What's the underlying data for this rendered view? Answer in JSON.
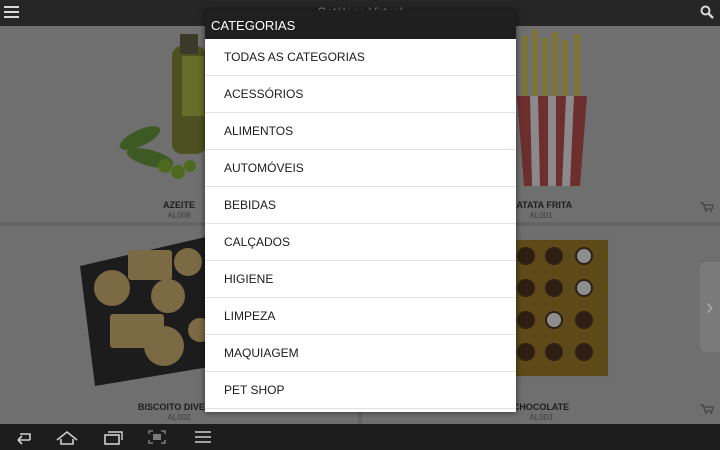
{
  "app": {
    "title": "Catálogo Virtual"
  },
  "topbar": {
    "menu_icon": "menu-icon",
    "search_icon": "search-icon"
  },
  "products": [
    {
      "name": "AZEITE",
      "code": "AL008",
      "image": "olive-oil-bottle"
    },
    {
      "name": "BATATA FRITA",
      "code": "AL001",
      "image": "french-fries"
    },
    {
      "name": "BISCOITO DIVE",
      "code": "AL002",
      "image": "biscuit-tray"
    },
    {
      "name": "CHOCOLATE",
      "code": "AL003",
      "image": "chocolate-box"
    }
  ],
  "category_dialog": {
    "title": "CATEGORIAS",
    "items": [
      "TODAS AS CATEGORIAS",
      "ACESSÓRIOS",
      "ALIMENTOS",
      "AUTOMÓVEIS",
      "BEBIDAS",
      "CALÇADOS",
      "HIGIENE",
      "LIMPEZA",
      "MAQUIAGEM",
      "PET SHOP"
    ]
  },
  "navbar": {
    "icons": [
      "back-icon",
      "home-icon",
      "recent-apps-icon",
      "screenshot-icon",
      "menu-icon"
    ]
  },
  "colors": {
    "dialog_header": "#1f1f1f",
    "dialog_body": "#ffffff",
    "dim_overlay": "#646464"
  }
}
